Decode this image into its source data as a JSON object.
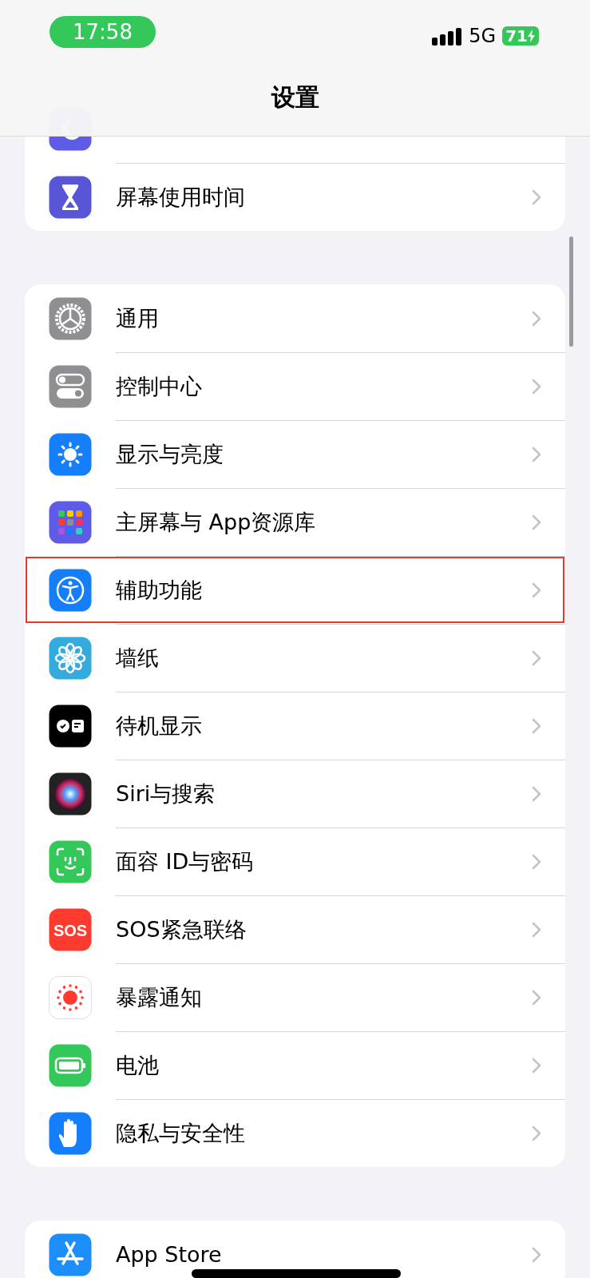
{
  "status_bar": {
    "time": "17:58",
    "network": "5G",
    "battery": "71",
    "charging": true
  },
  "title": "设置",
  "groups": [
    {
      "items": [
        {
          "kind": "cut"
        },
        {
          "kind": "row",
          "label": "屏幕使用时间",
          "highlighted": false
        }
      ]
    },
    {
      "items": [
        {
          "kind": "row",
          "label": "通用",
          "highlighted": false
        },
        {
          "kind": "row",
          "label": "控制中心",
          "highlighted": false
        },
        {
          "kind": "row",
          "label": "显示与亮度",
          "highlighted": false
        },
        {
          "kind": "row",
          "label": "主屏幕与 App资源库",
          "highlighted": false
        },
        {
          "kind": "row",
          "label": "辅助功能",
          "highlighted": true
        },
        {
          "kind": "row",
          "label": "墙纸",
          "highlighted": false
        },
        {
          "kind": "row",
          "label": "待机显示",
          "highlighted": false
        },
        {
          "kind": "row",
          "label": "Siri与搜索",
          "highlighted": false
        },
        {
          "kind": "row",
          "label": "面容 ID与密码",
          "highlighted": false
        },
        {
          "kind": "row",
          "label": "SOS紧急联络",
          "highlighted": false,
          "icon_text": "SOS"
        },
        {
          "kind": "row",
          "label": "暴露通知",
          "highlighted": false
        },
        {
          "kind": "row",
          "label": "电池",
          "highlighted": false
        },
        {
          "kind": "row",
          "label": "隐私与安全性",
          "highlighted": false
        }
      ]
    },
    {
      "items": [
        {
          "kind": "row",
          "label": "App Store",
          "highlighted": false
        }
      ]
    }
  ]
}
